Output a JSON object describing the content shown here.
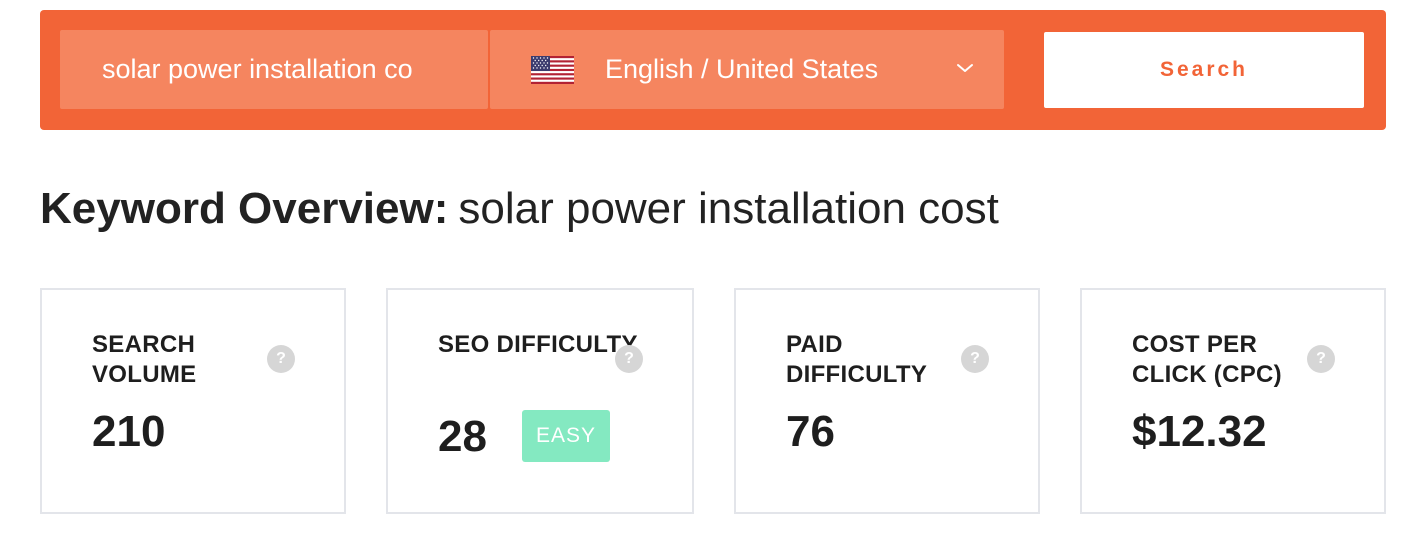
{
  "search": {
    "keyword_value": "solar power installation co",
    "language_label": "English / United States",
    "country_flag": "us-flag-icon",
    "button_label": "Search",
    "accent_color": "#f26437"
  },
  "overview": {
    "title_label": "Keyword Overview:",
    "title_keyword": "solar power installation cost"
  },
  "metrics": [
    {
      "label": "SEARCH VOLUME",
      "value": "210",
      "help": "?"
    },
    {
      "label": "SEO DIFFICULTY",
      "value": "28",
      "badge": "EASY",
      "badge_color": "#84e9c1",
      "help": "?"
    },
    {
      "label": "PAID DIFFICULTY",
      "value": "76",
      "help": "?"
    },
    {
      "label": "COST PER CLICK (CPC)",
      "value": "$12.32",
      "help": "?"
    }
  ]
}
